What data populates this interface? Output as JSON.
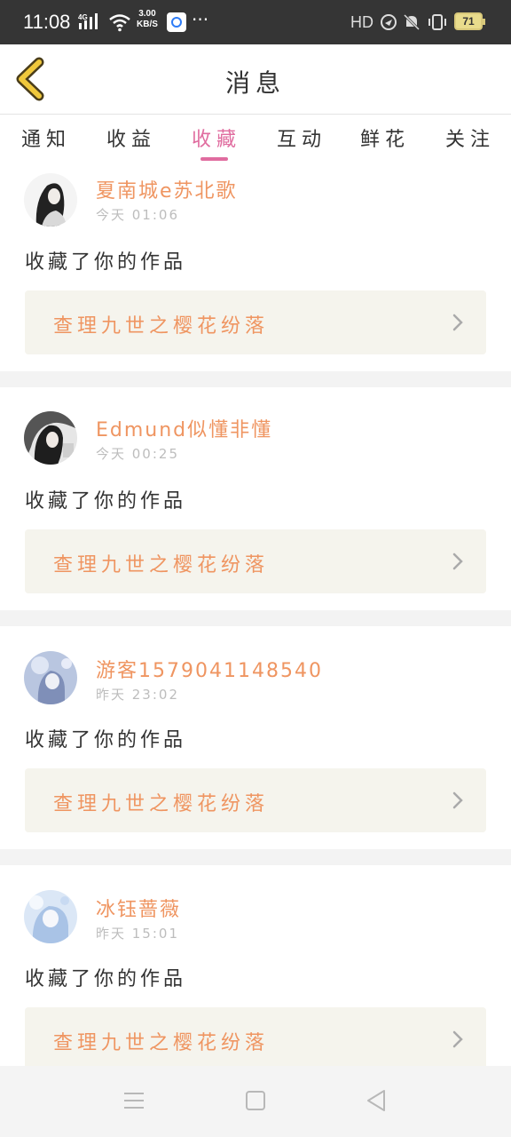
{
  "status_bar": {
    "time": "11:08",
    "network": "4G",
    "speed_value": "3.00",
    "speed_unit": "KB/S",
    "more": "···",
    "hd": "HD",
    "battery": "71"
  },
  "header": {
    "back_icon": "chevron-left-icon",
    "title": "消息"
  },
  "tabs": [
    {
      "label": "通知",
      "active": false
    },
    {
      "label": "收益",
      "active": false
    },
    {
      "label": "收藏",
      "active": true
    },
    {
      "label": "互动",
      "active": false
    },
    {
      "label": "鲜花",
      "active": false
    },
    {
      "label": "关注",
      "active": false
    }
  ],
  "colors": {
    "accent_pink": "#e06c9f",
    "name_orange": "#ef9561",
    "back_yellow": "#f0c83c"
  },
  "items": [
    {
      "user": "夏南城e苏北歌",
      "time": "今天 01:06",
      "action": "收藏了你的作品",
      "work": "查理九世之樱花纷落"
    },
    {
      "user": "Edmund似懂非懂",
      "time": "今天 00:25",
      "action": "收藏了你的作品",
      "work": "查理九世之樱花纷落"
    },
    {
      "user": "游客1579041148540",
      "time": "昨天 23:02",
      "action": "收藏了你的作品",
      "work": "查理九世之樱花纷落"
    },
    {
      "user": "冰钰蔷薇",
      "time": "昨天 15:01",
      "action": "收藏了你的作品",
      "work": "查理九世之樱花纷落"
    }
  ],
  "nav": {
    "menu_icon": "menu-icon",
    "home_icon": "home-icon",
    "back_icon": "back-triangle-icon"
  }
}
